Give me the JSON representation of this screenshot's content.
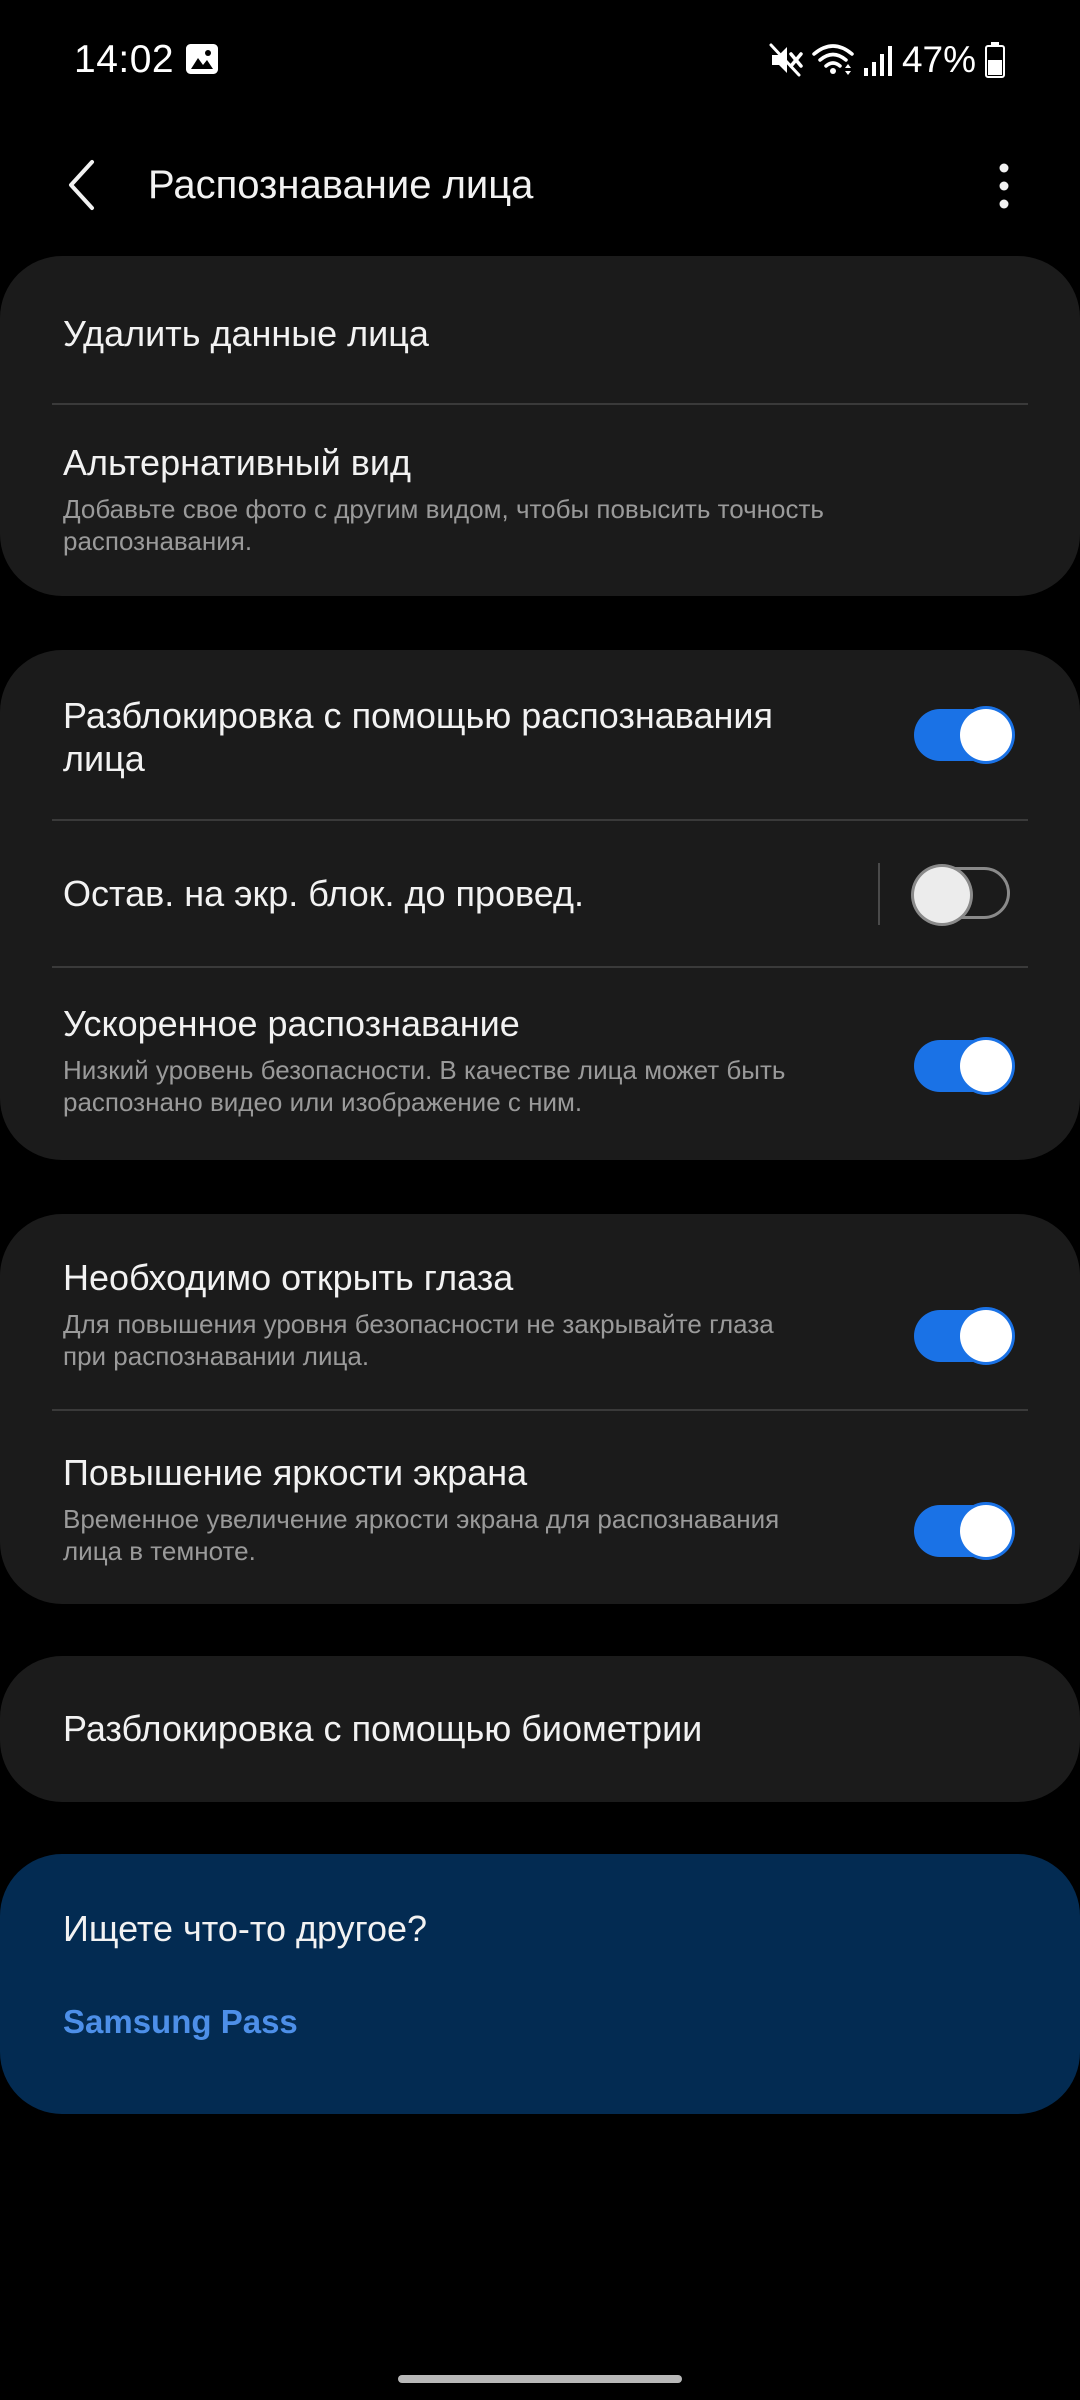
{
  "status_bar": {
    "time": "14:02",
    "battery_percent": "47%",
    "icons": [
      "image-icon",
      "mute-icon",
      "wifi-icon",
      "signal-icon",
      "battery-icon"
    ]
  },
  "app_bar": {
    "title": "Распознавание лица",
    "back_icon": "chevron-left-icon",
    "more_icon": "more-vertical-icon"
  },
  "group1": {
    "delete_face": {
      "title": "Удалить данные лица"
    },
    "alt_look": {
      "title": "Альтернативный вид",
      "sub_line1": "Добавьте свое фото с другим видом, чтобы повысить точность",
      "sub_line2": "распознавания."
    }
  },
  "group2": {
    "face_unlock": {
      "title_line1": "Разблокировка с помощью распознавания",
      "title_line2": "лица",
      "enabled": true
    },
    "stay_on_lock": {
      "title": "Остав. на экр. блок. до провед.",
      "enabled": false
    },
    "faster_recognition": {
      "title": "Ускоренное распознавание",
      "sub_line1": "Низкий уровень безопасности. В качестве лица может быть",
      "sub_line2": "распознано видео или изображение с ним.",
      "enabled": true
    }
  },
  "group3": {
    "open_eyes": {
      "title": "Необходимо открыть глаза",
      "sub_line1": "Для повышения уровня безопасности не закрывайте глаза",
      "sub_line2": "при распознавании лица.",
      "enabled": true
    },
    "brighten_screen": {
      "title": "Повышение яркости экрана",
      "sub_line1": "Временное увеличение яркости экрана для распознавания",
      "sub_line2": "лица в темноте.",
      "enabled": true
    }
  },
  "group4": {
    "biometrics_unlock": {
      "title": "Разблокировка с помощью биометрии"
    }
  },
  "suggestions": {
    "title": "Ищете что-то другое?",
    "link": "Samsung Pass"
  },
  "colors": {
    "background": "#000000",
    "card": "#1b1b1b",
    "accent": "#1a72e6",
    "suggest_card": "#032b52",
    "link": "#4d8fe8"
  }
}
